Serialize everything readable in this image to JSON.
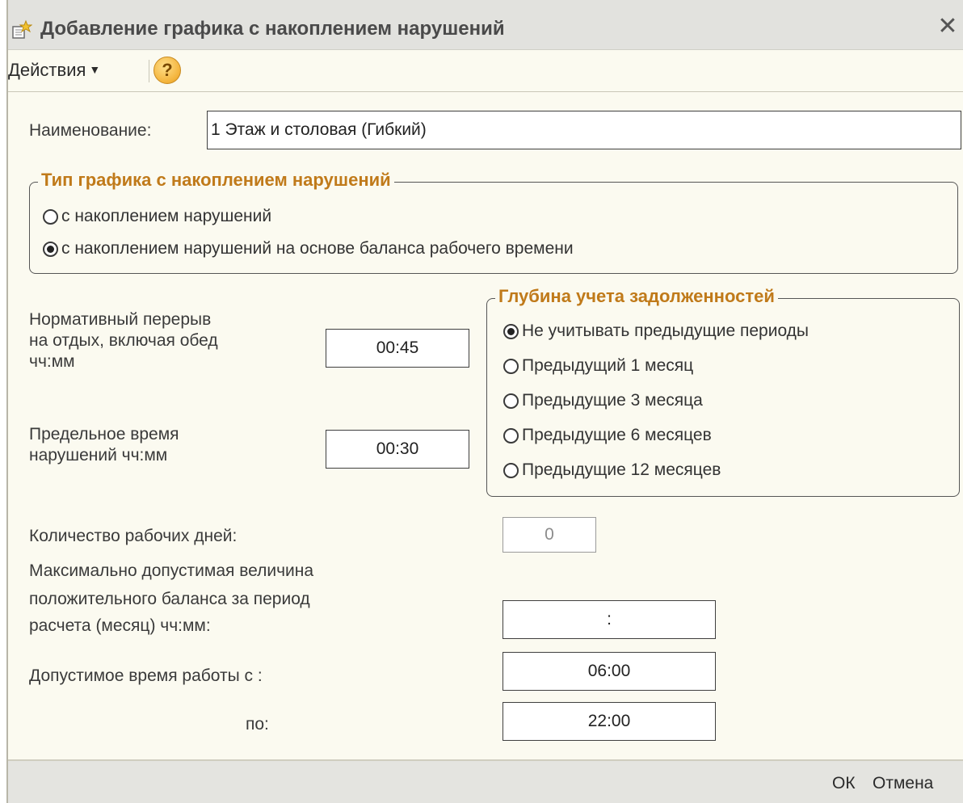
{
  "window": {
    "title": "Добавление  графика с накоплением нарушений",
    "close": "✕"
  },
  "menu": {
    "actions_label": "Действия",
    "help_label": "?"
  },
  "form": {
    "name_label": "Наименование:",
    "name_value": "1 Этаж и столовая (Гибкий)",
    "type_group": {
      "title": "Тип  графика с накоплением нарушений",
      "options": [
        "с накоплением нарушений",
        "с накоплением нарушений на основе баланса рабочего времени"
      ],
      "selected": 1
    },
    "break_label_1": "Нормативный перерыв",
    "break_label_2": "на отдых, включая обед",
    "break_label_3": "чч:мм",
    "break_value": "00:45",
    "limit_label_1": "Предельное время",
    "limit_label_2": "нарушений чч:мм",
    "limit_value": "00:30",
    "depth_group": {
      "title": "Глубина учета задолженностей",
      "options": [
        "Не учитывать предыдущие периоды",
        "Предыдущий 1 месяц",
        "Предыдущие 3 месяца",
        "Предыдущие 6 месяцев",
        "Предыдущие 12 месяцев"
      ],
      "selected": 0
    },
    "workdays_label": "Количество рабочих дней:",
    "workdays_value": "0",
    "max_balance_label_1": "Максимально допустимая величина",
    "max_balance_label_2": "положительного баланса за период",
    "max_balance_label_3": "расчета (месяц) чч:мм:",
    "max_balance_value": ":",
    "work_from_label": "Допустимое время работы с :",
    "work_from_value": "06:00",
    "work_to_label": "по:",
    "work_to_value": "22:00"
  },
  "footer": {
    "ok_label": "ОК",
    "cancel_label": "Отмена"
  }
}
